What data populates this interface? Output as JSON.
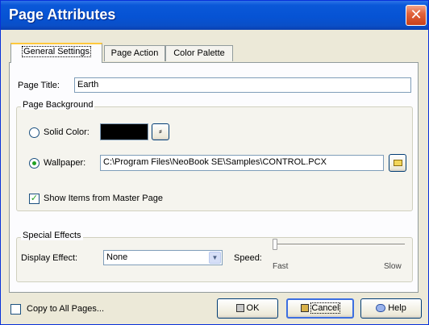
{
  "window": {
    "title": "Page Attributes",
    "close_glyph": "✕"
  },
  "tabs": [
    {
      "label": "General Settings"
    },
    {
      "label": "Page Action"
    },
    {
      "label": "Color Palette"
    }
  ],
  "page_title": {
    "label": "Page Title:",
    "value": "Earth"
  },
  "background": {
    "legend": "Page Background",
    "solid_color_label": "Solid Color:",
    "solid_color_value": "#000000",
    "picker_glyph": "⸗",
    "wallpaper_label": "Wallpaper:",
    "wallpaper_path": "C:\\Program Files\\NeoBook SE\\Samples\\CONTROL.PCX",
    "selected": "wallpaper"
  },
  "master_page": {
    "label": "Show Items from Master Page",
    "checked": true
  },
  "effects": {
    "legend": "Special Effects",
    "display_effect_label": "Display Effect:",
    "display_effect_value": "None",
    "speed_label": "Speed:",
    "fast_label": "Fast",
    "slow_label": "Slow",
    "speed_value": 0
  },
  "footer": {
    "copy_label": "Copy to All Pages...",
    "copy_checked": false,
    "ok_label": "OK",
    "cancel_label": "Cancel",
    "help_label": "Help"
  }
}
